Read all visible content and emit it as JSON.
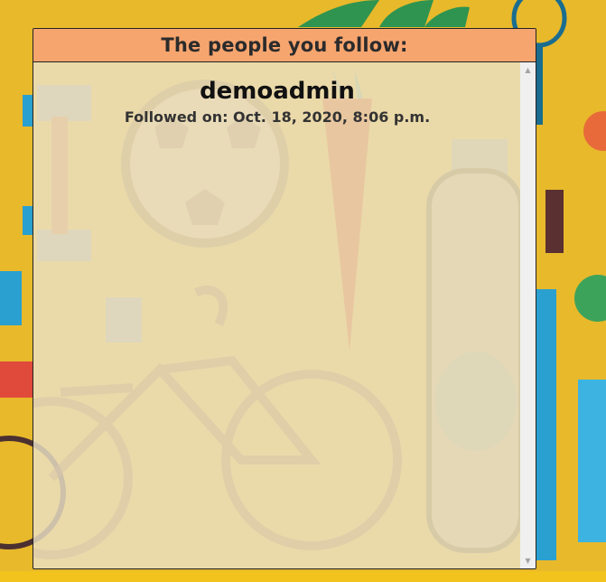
{
  "panel": {
    "title": "The people you follow:"
  },
  "follows": [
    {
      "username": "demoadmin",
      "followed_on": "Followed on: Oct. 18, 2020, 8:06 p.m."
    }
  ],
  "colors": {
    "page_background": "#e8b92b",
    "header_background": "#f7a56f",
    "panel_background": "#ece2c6"
  },
  "icons": {
    "background_art": [
      "soccer-ball-icon",
      "carrot-icon",
      "bicycle-icon",
      "bottle-icon",
      "dumbbell-icon",
      "tennis-racket-icon"
    ],
    "scroll_up": "triangle-up-icon",
    "scroll_down": "triangle-down-icon"
  }
}
